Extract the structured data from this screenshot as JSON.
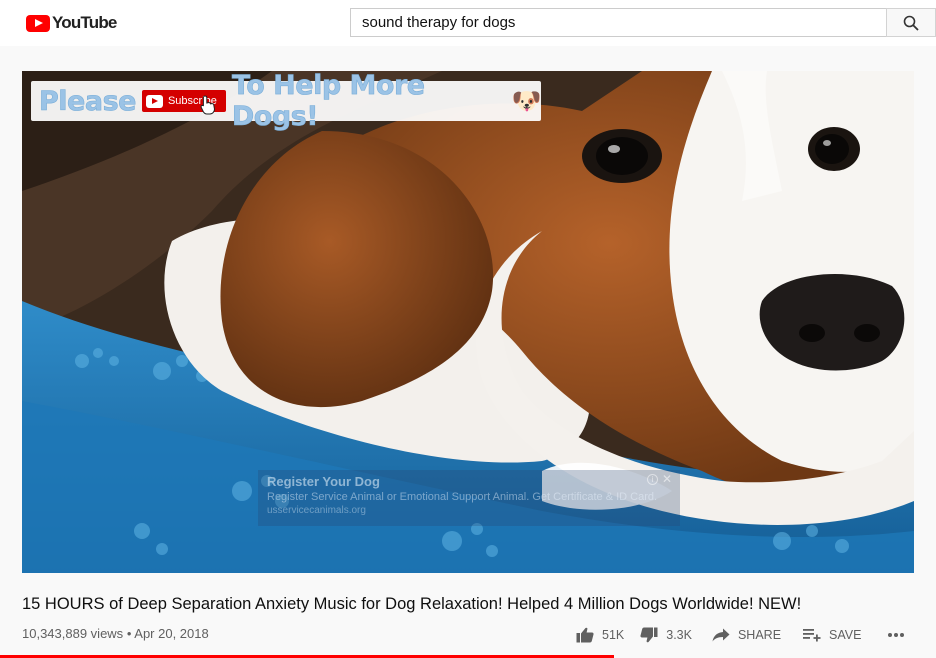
{
  "header": {
    "logo_text": "YouTube",
    "search_value": "sound therapy for dogs",
    "search_icon": "search-icon"
  },
  "player": {
    "overlay": {
      "text_before": "Please",
      "subscribe_label": "Subscribe",
      "text_after": "To Help More Dogs!",
      "emoji": "🐶"
    },
    "ad": {
      "title": "Register Your Dog",
      "description": "Register Service Animal or Emotional Support Animal. Get Certificate & ID Card.",
      "url": "usservicecanimals.org",
      "info_icon": "info-icon",
      "close_icon": "close-icon"
    }
  },
  "video": {
    "title": "15 HOURS of Deep Separation Anxiety Music for Dog Relaxation! Helped 4 Million Dogs Worldwide! NEW!",
    "views": "10,343,889 views",
    "separator": "•",
    "date": "Apr 20, 2018",
    "likes": "51K",
    "dislikes": "3.3K",
    "share_label": "SHARE",
    "save_label": "SAVE"
  },
  "colors": {
    "brand_red": "#ff0000",
    "text_secondary": "#606060"
  }
}
